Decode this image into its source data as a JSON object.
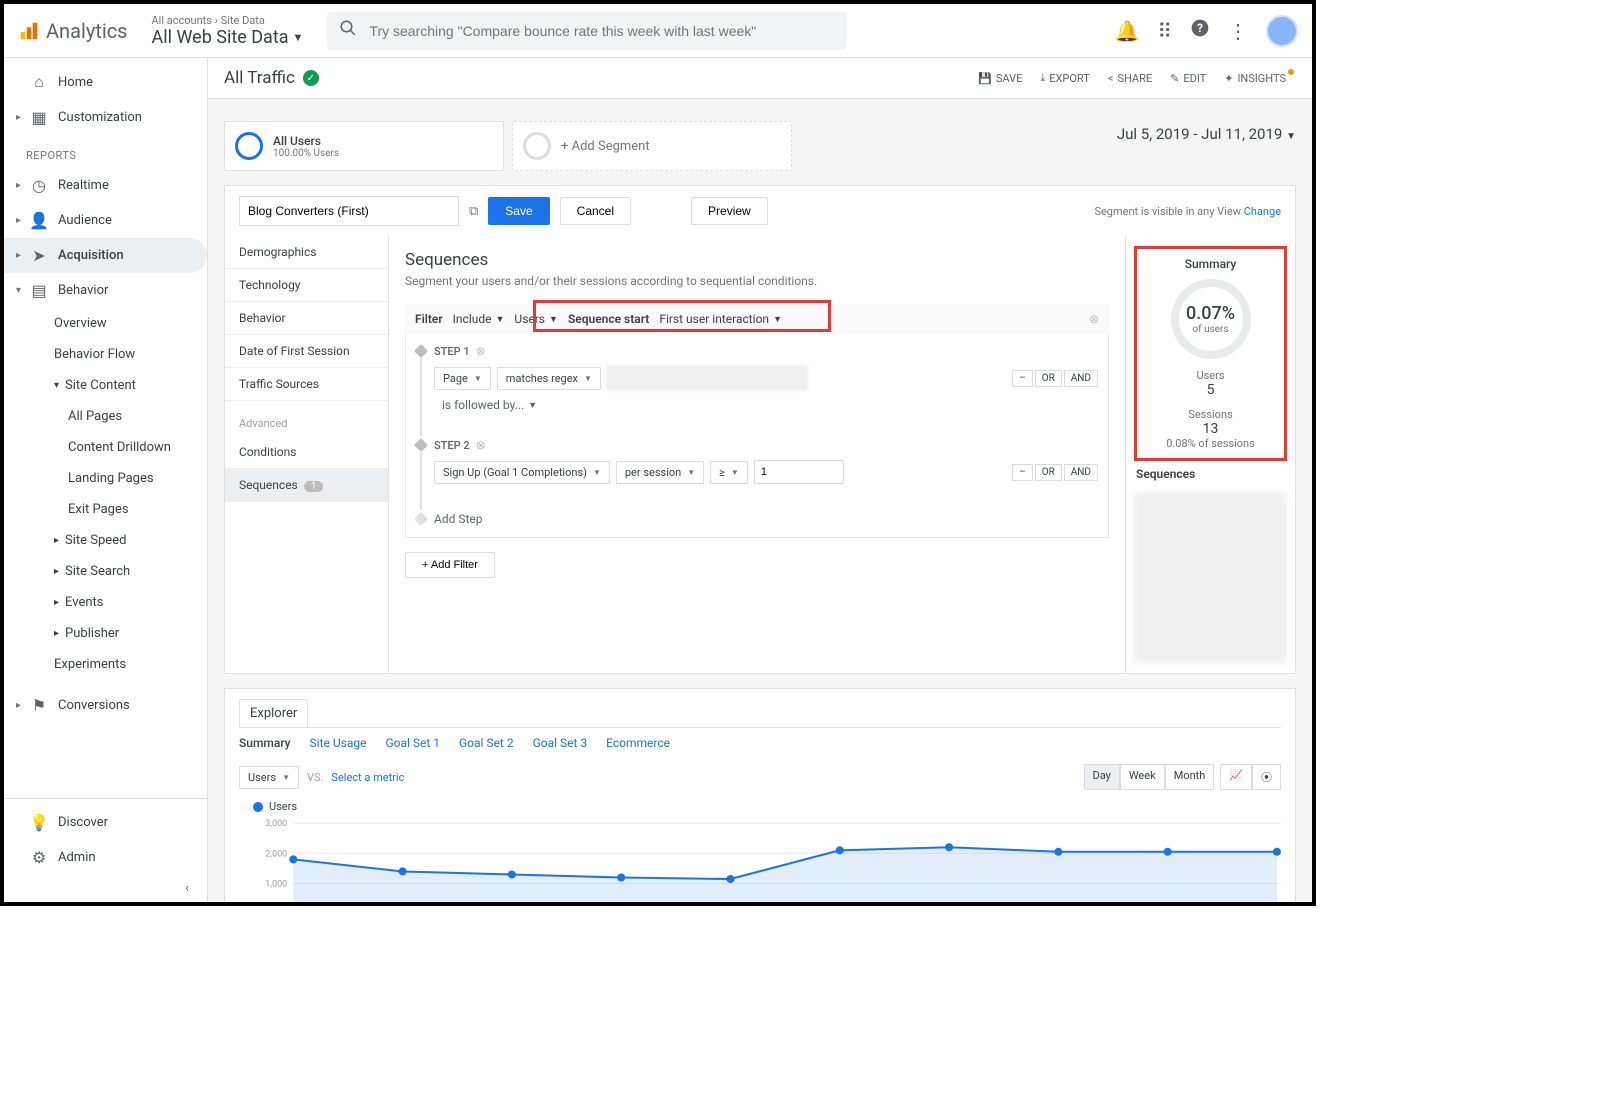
{
  "header": {
    "app_name": "Analytics",
    "crumb1": "All accounts",
    "crumb2": "Site Data",
    "view_selector": "All Web Site Data",
    "search_placeholder": "Try searching \"Compare bounce rate this week with last week\""
  },
  "nav": {
    "home": "Home",
    "customization": "Customization",
    "reports_header": "REPORTS",
    "realtime": "Realtime",
    "audience": "Audience",
    "acquisition": "Acquisition",
    "behavior": "Behavior",
    "behavior_items": {
      "overview": "Overview",
      "flow": "Behavior Flow",
      "site_content": "Site Content",
      "all_pages": "All Pages",
      "content_drill": "Content Drilldown",
      "landing": "Landing Pages",
      "exit": "Exit Pages",
      "site_speed": "Site Speed",
      "site_search": "Site Search",
      "events": "Events",
      "publisher": "Publisher",
      "experiments": "Experiments"
    },
    "conversions": "Conversions",
    "discover": "Discover",
    "admin": "Admin"
  },
  "toolbar": {
    "page_title": "All Traffic",
    "save": "SAVE",
    "export": "EXPORT",
    "share": "SHARE",
    "edit": "EDIT",
    "insights": "INSIGHTS"
  },
  "segments": {
    "all_users_name": "All Users",
    "all_users_sub": "100.00% Users",
    "add_segment": "+ Add Segment",
    "date_range": "Jul 5, 2019 - Jul 11, 2019"
  },
  "builder": {
    "segment_name": "Blog Converters (First)",
    "save": "Save",
    "cancel": "Cancel",
    "preview": "Preview",
    "visible_text": "Segment is visible in any View",
    "change": "Change",
    "options": {
      "demographics": "Demographics",
      "technology": "Technology",
      "behavior": "Behavior",
      "date_first": "Date of First Session",
      "traffic_sources": "Traffic Sources",
      "advanced": "Advanced",
      "conditions": "Conditions",
      "sequences": "Sequences",
      "sequences_count": "1"
    },
    "seq": {
      "title": "Sequences",
      "desc": "Segment your users and/or their sessions according to sequential conditions.",
      "filter_label": "Filter",
      "include": "Include",
      "scope": "Users",
      "seq_start_label": "Sequence start",
      "seq_start_value": "First user interaction",
      "step1": "STEP 1",
      "step2": "STEP 2",
      "dim_page": "Page",
      "op_regex": "matches regex",
      "followed": "is followed by...",
      "dim_goal": "Sign Up (Goal 1 Completions)",
      "scope_session": "per session",
      "op_gte": "≥",
      "val_1": "1",
      "minus": "–",
      "or": "OR",
      "and": "AND",
      "add_step": "Add Step",
      "add_filter": "+ Add Filter"
    },
    "summary": {
      "title": "Summary",
      "pct": "0.07%",
      "pct_sub": "of users",
      "users_label": "Users",
      "users_val": "5",
      "sessions_label": "Sessions",
      "sessions_val": "13",
      "sessions_pct": "0.08% of sessions",
      "seq_header": "Sequences"
    }
  },
  "explorer": {
    "tab": "Explorer",
    "sub": {
      "summary": "Summary",
      "site_usage": "Site Usage",
      "gs1": "Goal Set 1",
      "gs2": "Goal Set 2",
      "gs3": "Goal Set 3",
      "ecom": "Ecommerce"
    },
    "metric1": "Users",
    "vs": "VS.",
    "select_metric": "Select a metric",
    "granularity": {
      "day": "Day",
      "week": "Week",
      "month": "Month"
    },
    "legend_users": "Users"
  },
  "chart_data": {
    "type": "line",
    "series": [
      {
        "name": "Users",
        "values": [
          1800,
          1400,
          1300,
          1200,
          1150,
          2100,
          2200,
          2050,
          2050,
          2050
        ]
      }
    ],
    "x": [
      0,
      1,
      2,
      3,
      4,
      5,
      6,
      7,
      8,
      9
    ],
    "ylim": [
      0,
      3000
    ],
    "yticks": [
      1000,
      2000,
      3000
    ],
    "ylabel": "",
    "xlabel": ""
  }
}
